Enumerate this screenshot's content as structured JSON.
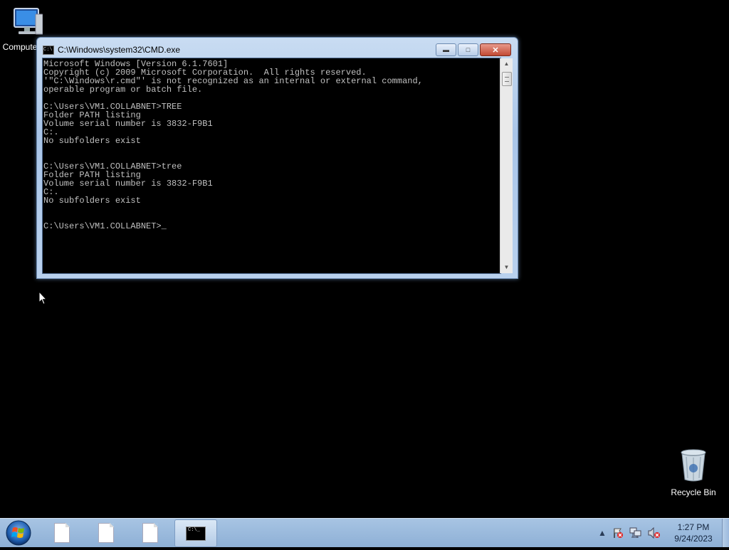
{
  "desktop": {
    "computer_label": "Computer",
    "recycle_label": "Recycle Bin"
  },
  "cmd_window": {
    "title": "C:\\Windows\\system32\\CMD.exe",
    "minimize_icon": "minimize-icon",
    "maximize_icon": "maximize-icon",
    "close_icon": "close-icon",
    "lines": [
      "Microsoft Windows [Version 6.1.7601]",
      "Copyright (c) 2009 Microsoft Corporation.  All rights reserved.",
      "'\"C:\\Windows\\r.cmd\"' is not recognized as an internal or external command,",
      "operable program or batch file.",
      "",
      "C:\\Users\\VM1.COLLABNET>TREE",
      "Folder PATH listing",
      "Volume serial number is 3832-F9B1",
      "C:.",
      "No subfolders exist",
      "",
      "",
      "C:\\Users\\VM1.COLLABNET>tree",
      "Folder PATH listing",
      "Volume serial number is 3832-F9B1",
      "C:.",
      "No subfolders exist",
      "",
      "",
      "C:\\Users\\VM1.COLLABNET>_"
    ]
  },
  "taskbar": {
    "start_icon": "windows-start-icon",
    "items": [
      {
        "icon": "document-icon",
        "active": false
      },
      {
        "icon": "document-icon",
        "active": false
      },
      {
        "icon": "document-icon",
        "active": false
      },
      {
        "icon": "cmd-icon",
        "active": true,
        "icon_text": "C:\\_"
      }
    ],
    "tray": {
      "icons": [
        "show-hidden-icons",
        "action-center-icon",
        "network-icon",
        "volume-muted-icon"
      ]
    },
    "clock": {
      "time": "1:27 PM",
      "date": "9/24/2023"
    }
  }
}
